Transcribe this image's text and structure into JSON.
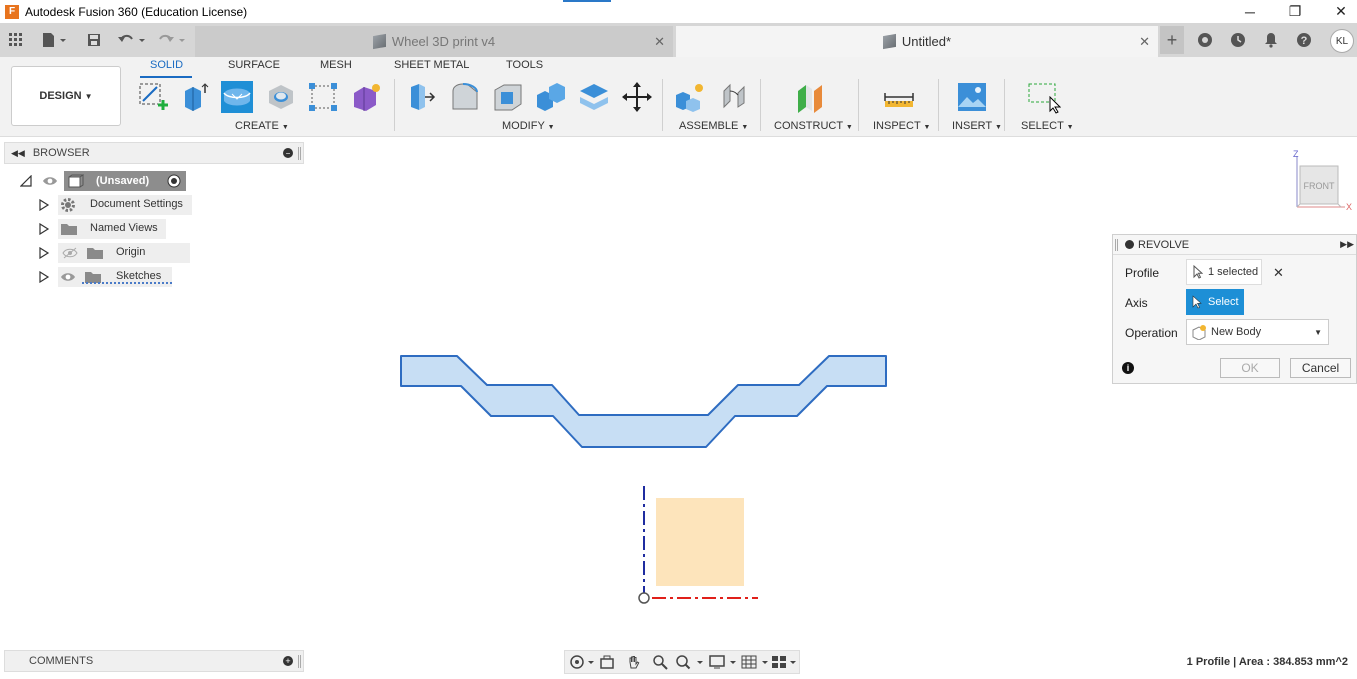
{
  "window": {
    "title": "Autodesk Fusion 360 (Education License)",
    "app_icon_letter": "F",
    "minimize": "─",
    "restore": "❐",
    "close": "✕"
  },
  "tabs": {
    "items": [
      {
        "label": "Wheel 3D print v4",
        "active": false
      },
      {
        "label": "Untitled*",
        "active": true
      }
    ],
    "new_tab": "+",
    "avatar_initials": "KL"
  },
  "toolbar": {
    "workspace": "DESIGN",
    "workspace_tabs": [
      "SOLID",
      "SURFACE",
      "MESH",
      "SHEET METAL",
      "TOOLS"
    ],
    "groups": [
      "CREATE",
      "MODIFY",
      "ASSEMBLE",
      "CONSTRUCT",
      "INSPECT",
      "INSERT",
      "SELECT"
    ],
    "accent": "#1f8fd6"
  },
  "browser": {
    "title": "BROWSER",
    "root": "(Unsaved)",
    "items": [
      "Document Settings",
      "Named Views",
      "Origin",
      "Sketches"
    ]
  },
  "viewcube": {
    "face": "FRONT",
    "axis_z": "Z",
    "axis_x": "X"
  },
  "revolve": {
    "title": "REVOLVE",
    "profile_label": "Profile",
    "profile_value": "1 selected",
    "axis_label": "Axis",
    "axis_value": "Select",
    "operation_label": "Operation",
    "operation_value": "New Body",
    "ok": "OK",
    "cancel": "Cancel",
    "info": "i"
  },
  "comments": {
    "title": "COMMENTS"
  },
  "status": {
    "text": "1 Profile | Area : 384.853 mm^2"
  }
}
